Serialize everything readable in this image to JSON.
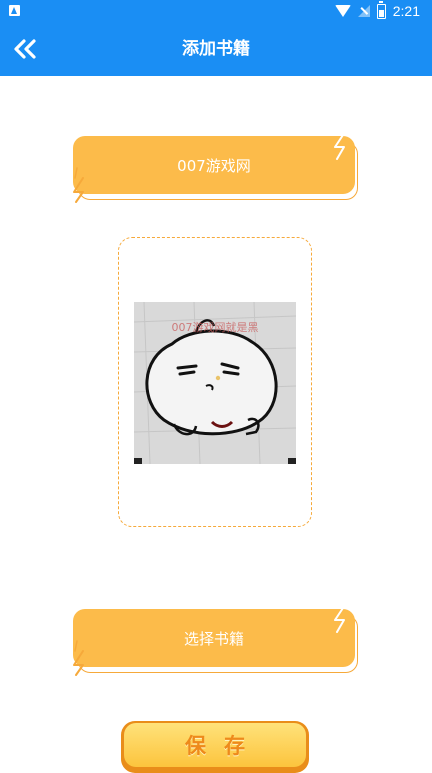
{
  "status_bar": {
    "time": "2:21",
    "icons": [
      "app-notification-icon",
      "wifi-icon",
      "signal-icon",
      "battery-icon"
    ]
  },
  "app_bar": {
    "title": "添加书籍",
    "back_icon": "double-chevron-left-icon"
  },
  "book_name_button": {
    "label": "007游戏网"
  },
  "image_preview": {
    "watermark_text": "007游戏网就是黑"
  },
  "choose_book_button": {
    "label": "选择书籍"
  },
  "save_button": {
    "label": "保存"
  },
  "colors": {
    "primary": "#1a8ef4",
    "button_orange": "#fcbb4a",
    "dashed_border": "#f6a93a",
    "save_text": "#ee8a1b"
  }
}
